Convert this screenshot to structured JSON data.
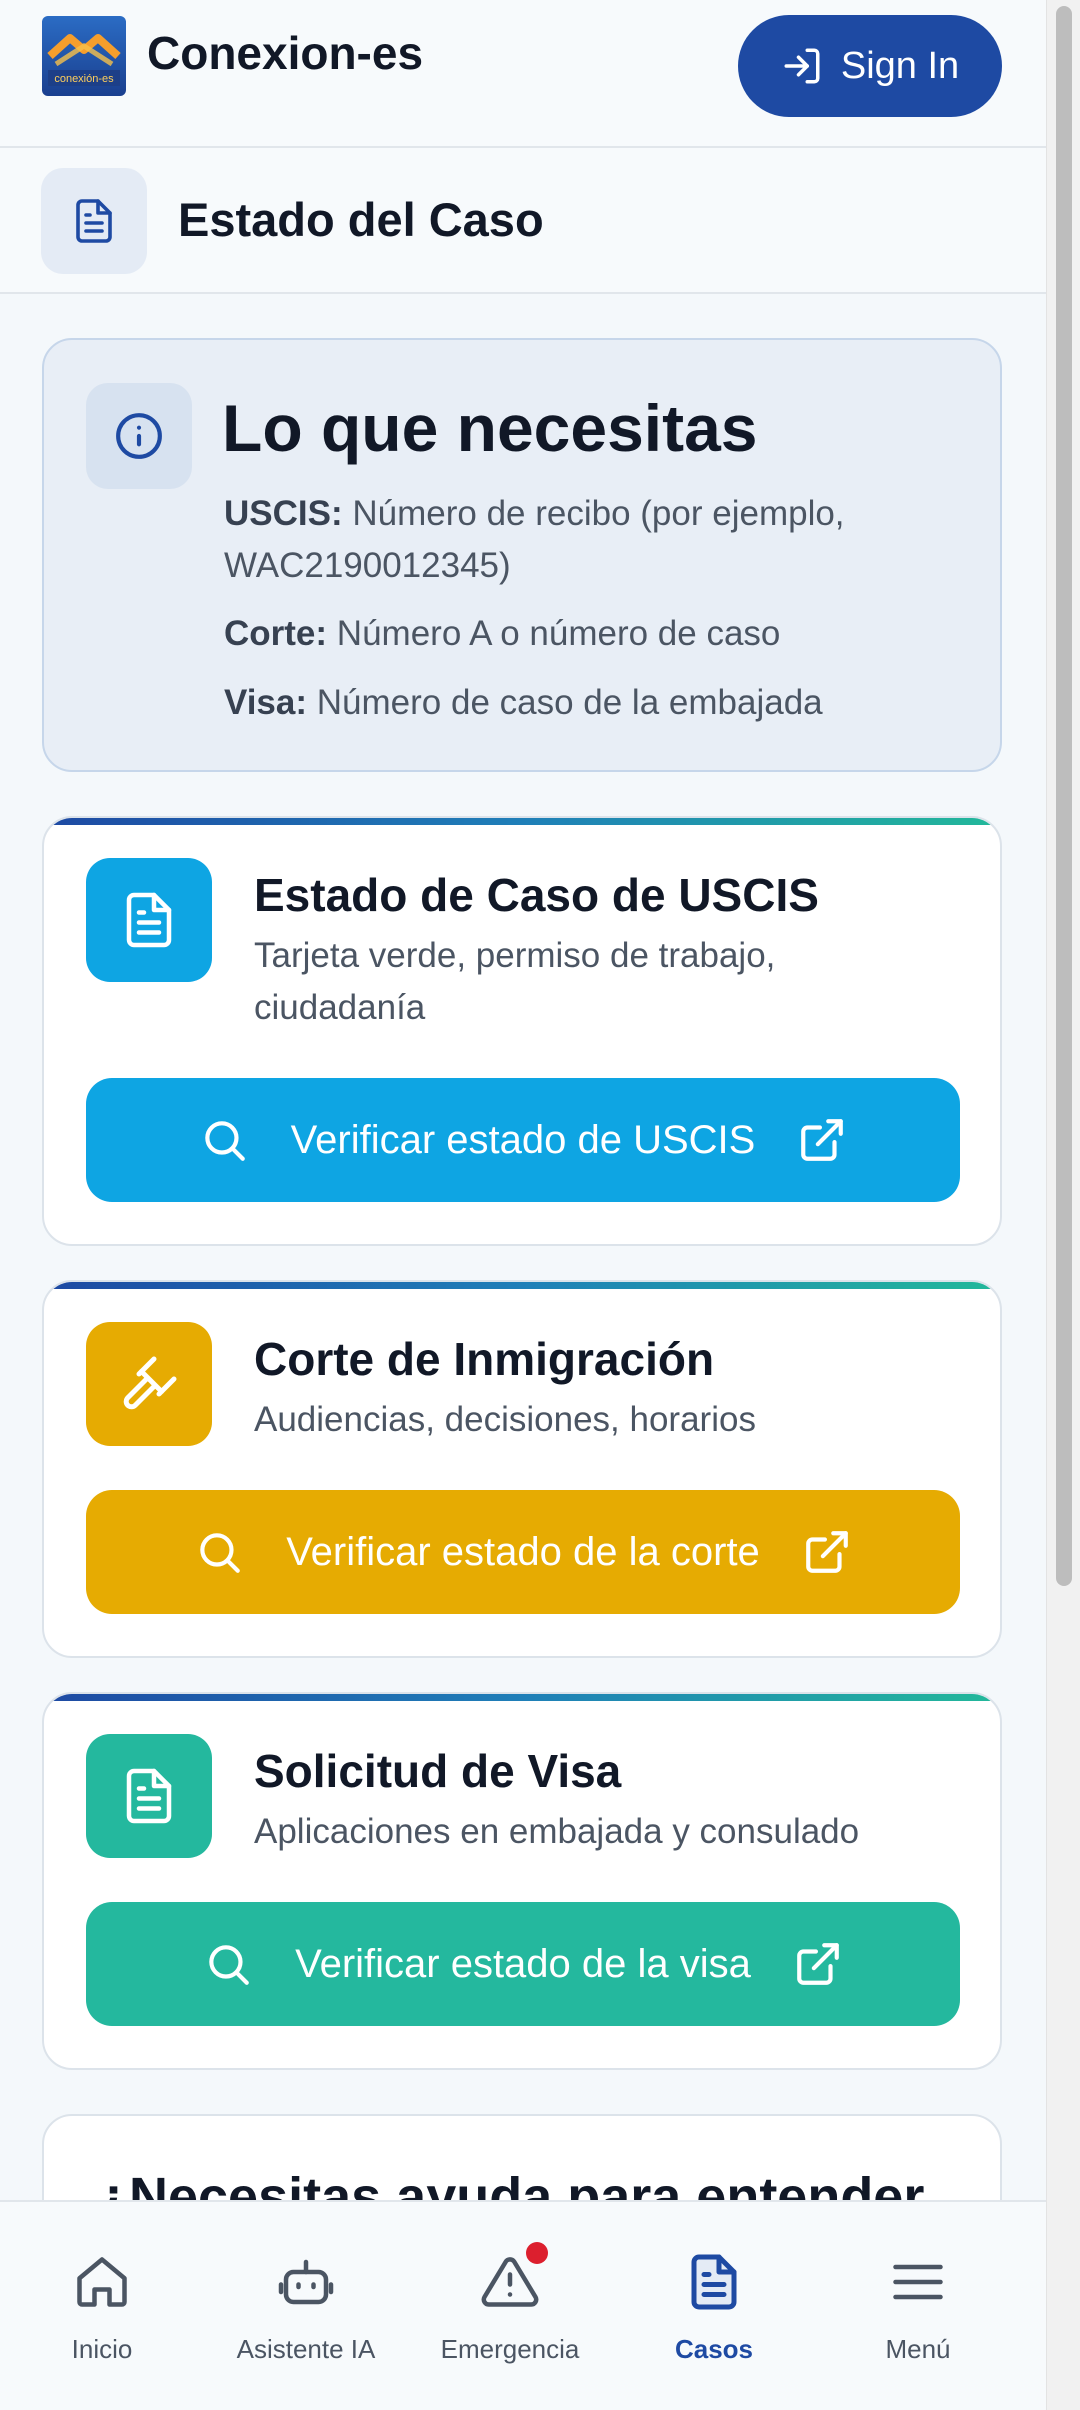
{
  "header": {
    "app_title": "Conexion-es",
    "logo_text": "conexión-es",
    "signin_label": "Sign In"
  },
  "subheader": {
    "title": "Estado del Caso"
  },
  "info": {
    "title": "Lo que necesitas",
    "items": [
      {
        "label": "USCIS:",
        "text": "Número de recibo (por ejemplo, WAC2190012345)"
      },
      {
        "label": "Corte:",
        "text": "Número A o número de caso"
      },
      {
        "label": "Visa:",
        "text": "Número de caso de la embajada"
      }
    ]
  },
  "cards": [
    {
      "name": "Estado de Caso de USCIS",
      "desc": "Tarjeta verde, permiso de trabajo, ciudadanía",
      "button": "Verificar estado de USCIS",
      "color": "#0ea5e3",
      "icon": "document-icon"
    },
    {
      "name": "Corte de Inmigración",
      "desc": "Audiencias, decisiones, horarios",
      "button": "Verificar estado de la corte",
      "color": "#e6ab02",
      "icon": "gavel-icon"
    },
    {
      "name": "Solicitud de Visa",
      "desc": "Aplicaciones en embajada y consulado",
      "button": "Verificar estado de la visa",
      "color": "#24b89e",
      "icon": "document-icon"
    }
  ],
  "help": {
    "title": "¿Necesitas ayuda para entender"
  },
  "nav": [
    {
      "label": "Inicio",
      "icon": "home-icon",
      "active": false
    },
    {
      "label": "Asistente IA",
      "icon": "robot-icon",
      "active": false
    },
    {
      "label": "Emergencia",
      "icon": "warning-icon",
      "active": false,
      "badge": true
    },
    {
      "label": "Casos",
      "icon": "document-icon",
      "active": true
    },
    {
      "label": "Menú",
      "icon": "menu-icon",
      "active": false
    }
  ],
  "colors": {
    "primary": "#1e4aa3",
    "badge": "#dc1f2e"
  }
}
